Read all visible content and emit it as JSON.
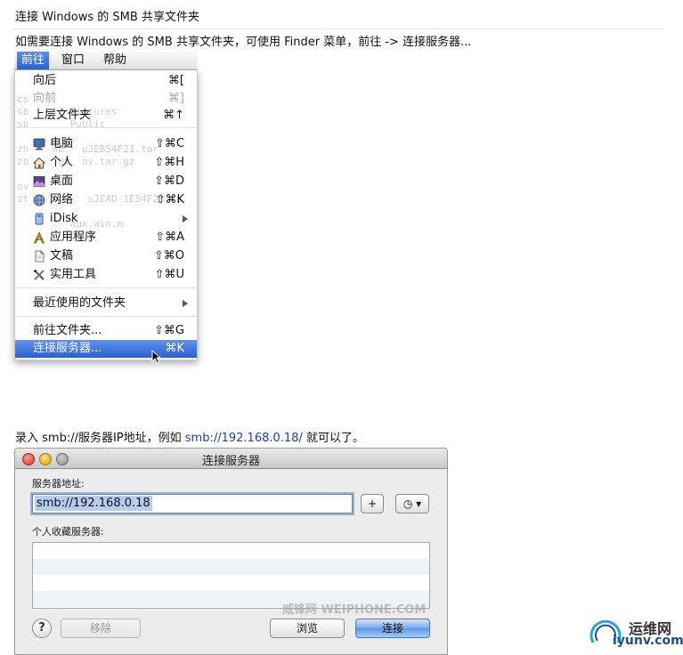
{
  "heading": "连接 Windows 的 SMB 共享文件夹",
  "intro": "如需要连接 Windows 的 SMB 共享文件夹，可使用 Finder 菜单，前往 -> 连接服务器...",
  "menubar": {
    "items": [
      "前往",
      "窗口",
      "帮助"
    ]
  },
  "menu": {
    "background_text": "cs\nsb       Pictures\nsb       Public\n\nzh    Wb   uJEB54F21.tar\nzb     ut  ov.tar.gz\n\nov\nzt          uJEAD-1E54F23.ta\n\n         aux.win.m",
    "items": [
      {
        "label": "向后",
        "shortcut": "⌘[",
        "icon": "",
        "disabled": false
      },
      {
        "label": "向前",
        "shortcut": "⌘]",
        "icon": "",
        "disabled": true
      },
      {
        "label": "上层文件夹",
        "shortcut": "⌘↑",
        "icon": "",
        "disabled": false
      },
      {
        "label": "电脑",
        "shortcut": "⇧⌘C",
        "icon": "computer-icon",
        "disabled": false
      },
      {
        "label": "个人",
        "shortcut": "⇧⌘H",
        "icon": "home-icon",
        "disabled": false
      },
      {
        "label": "桌面",
        "shortcut": "⇧⌘D",
        "icon": "desktop-icon",
        "disabled": false
      },
      {
        "label": "网络",
        "shortcut": "⇧⌘K",
        "icon": "network-icon",
        "disabled": false
      },
      {
        "label": "iDisk",
        "shortcut": "",
        "icon": "idisk-icon",
        "disabled": false
      },
      {
        "label": "应用程序",
        "shortcut": "⇧⌘A",
        "icon": "applications-icon",
        "disabled": false
      },
      {
        "label": "文稿",
        "shortcut": "⇧⌘O",
        "icon": "documents-icon",
        "disabled": false
      },
      {
        "label": "实用工具",
        "shortcut": "⇧⌘U",
        "icon": "utilities-icon",
        "disabled": false
      },
      {
        "label": "最近使用的文件夹",
        "shortcut": "",
        "icon": "",
        "disabled": false
      },
      {
        "label": "前往文件夹...",
        "shortcut": "⇧⌘G",
        "icon": "",
        "disabled": false
      },
      {
        "label": "连接服务器...",
        "shortcut": "⌘K",
        "icon": "",
        "disabled": false,
        "highlighted": true
      }
    ]
  },
  "para2": {
    "before": "录入 smb://服务器IP地址，例如 ",
    "link": "smb://192.168.0.18/",
    "after": " 就可以了。"
  },
  "dialog": {
    "title": "连接服务器",
    "address_label": "服务器地址:",
    "address_value": "smb://192.168.0.18",
    "add_button": "+",
    "history_button": "◷ ▾",
    "favorites_label": "个人收藏服务器:",
    "help_button": "?",
    "remove_button": "移除",
    "browse_button": "浏览",
    "connect_button": "连接",
    "watermark": "威锋网 WEIPHONE.COM"
  },
  "logo": {
    "cn": "运维网",
    "en": "iyunv.com"
  },
  "colors": {
    "menu_highlight": "#2a5fd3",
    "link": "#1a3bbf",
    "accent_blue": "#5d95e3"
  }
}
